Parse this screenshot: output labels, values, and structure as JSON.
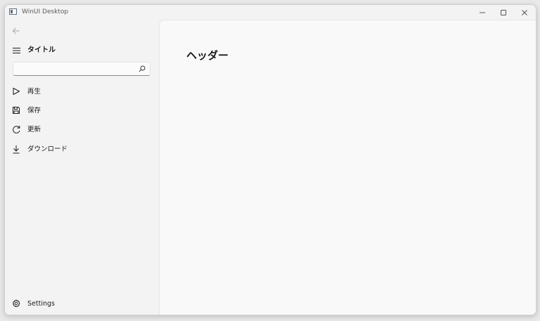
{
  "window": {
    "title": "WinUI Desktop"
  },
  "nav": {
    "pane_title": "タイトル",
    "search": {
      "value": "",
      "placeholder": ""
    },
    "items": [
      {
        "label": "再生",
        "icon": "play-icon"
      },
      {
        "label": "保存",
        "icon": "save-icon"
      },
      {
        "label": "更新",
        "icon": "refresh-icon"
      },
      {
        "label": "ダウンロード",
        "icon": "download-icon"
      }
    ],
    "footer": {
      "label": "Settings",
      "icon": "gear-icon"
    }
  },
  "content": {
    "header": "ヘッダー"
  },
  "colors": {
    "window_bg": "#f3f3f3",
    "content_bg": "#f9f9f9",
    "text": "#1a1a1a"
  }
}
